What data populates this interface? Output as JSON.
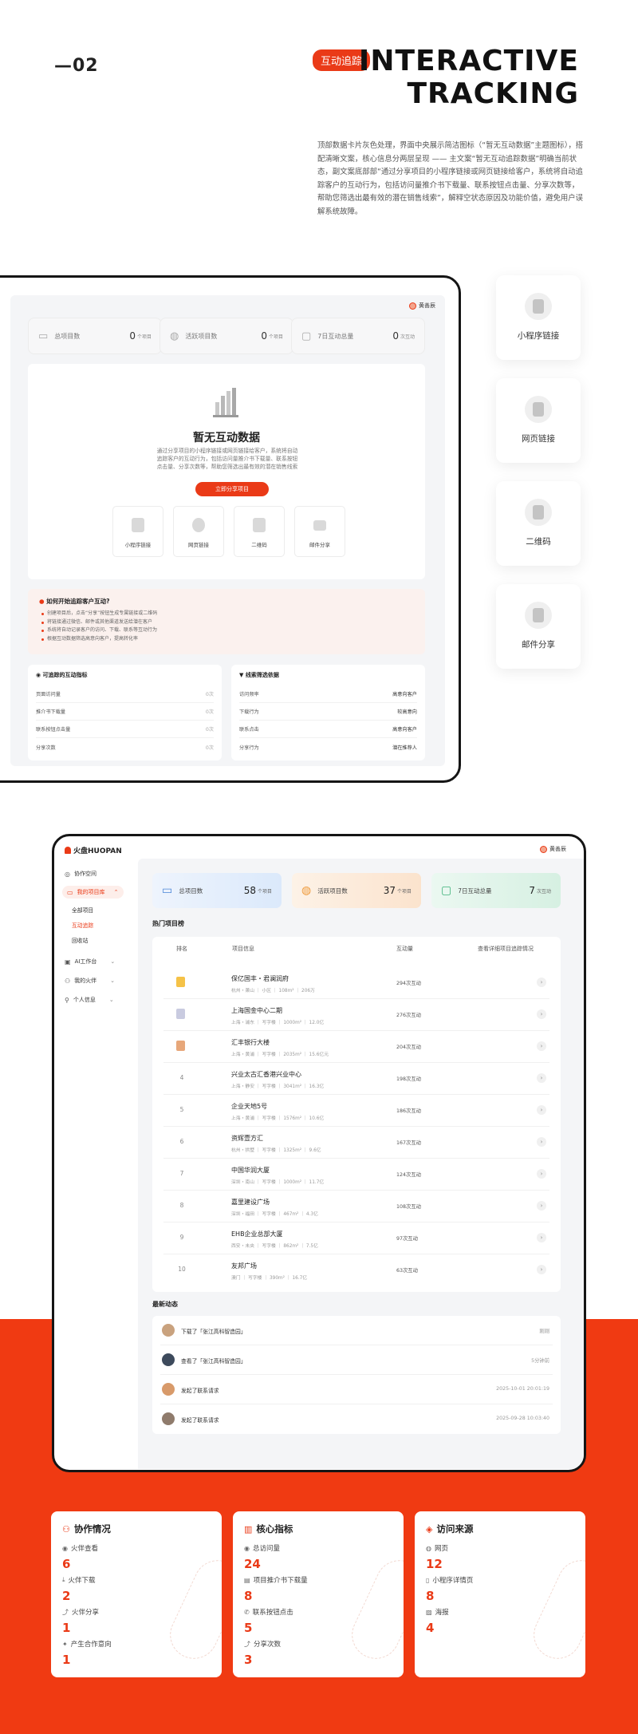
{
  "header": {
    "section_number": "—02",
    "tag": "互动追踪",
    "title_line1": "INTERACTIVE",
    "title_line2": "TRACKING",
    "description": "顶部数据卡片灰色处理，界面中央展示简洁图标（“暂无互动数据”主题图标），搭配清晰文案，核心信息分两层呈现 —— 主文案“暂无互动追踪数据”明确当前状态，副文案底部部“通过分享项目的小程序链接或网页链接给客户，系统将自动追踪客户的互动行为，包括访问量推介书下载量、联系按钮点击量、分享次数等，帮助您筛选出最有效的潜在销售线索”，解释空状态原因及功能价值，避免用户误解系统故障。"
  },
  "screen1": {
    "user": "黄善辰",
    "stats": [
      {
        "label": "总项目数",
        "value": "0",
        "unit": "个项目"
      },
      {
        "label": "活跃项目数",
        "value": "0",
        "unit": "个项目"
      },
      {
        "label": "7日互动总量",
        "value": "0",
        "unit": "次互动"
      }
    ],
    "empty_title": "暂无互动数据",
    "empty_desc": "通过分享项目的小程序链接或网页链接给客户，系统将自动追踪客户的互动行为，包括访问量推介书下载量、联系按钮点击量、分享次数等，帮助您筛选出最有效的潜在销售线索",
    "share_button": "立即分享项目",
    "share_options": [
      "小程序链接",
      "网页链接",
      "二维码",
      "邮件分享"
    ],
    "howto_title": "如何开始追踪客户互动?",
    "howto_items": [
      "创建项目后，点击“分享”按钮生成专属链接或二维码",
      "将链接通过微信、邮件或其他渠道发送给潜在客户",
      "系统将自动记录客户的访问、下载、联系等互动行为",
      "根据互动数据筛选高意向客户，提高转化率"
    ],
    "metrics_title": "可追踪的互动指标",
    "metrics": [
      {
        "label": "页面访问量",
        "value": "0次"
      },
      {
        "label": "推介书下载量",
        "value": "0次"
      },
      {
        "label": "联系按钮点击量",
        "value": "0次"
      },
      {
        "label": "分享次数",
        "value": "0次"
      }
    ],
    "leads_title": "线索筛选依据",
    "leads": [
      {
        "label": "访问频率",
        "value": "高意向客户"
      },
      {
        "label": "下载行为",
        "value": "较高意向"
      },
      {
        "label": "联系点击",
        "value": "高意向客户"
      },
      {
        "label": "分享行为",
        "value": "潜在推荐人"
      }
    ]
  },
  "side_cards": [
    "小程序链接",
    "网页链接",
    "二维码",
    "邮件分享"
  ],
  "screen2": {
    "brand": "火盘HUOPAN",
    "user": "黄善辰",
    "nav": {
      "collab": "协作空间",
      "my_projects": "我的项目库",
      "sub": [
        "全部项目",
        "互动追踪",
        "回收站"
      ],
      "ai": "AI工作台",
      "partners": "我的火伴",
      "profile": "个人信息"
    },
    "stats": [
      {
        "label": "总项目数",
        "value": "58",
        "unit": "个项目"
      },
      {
        "label": "活跃项目数",
        "value": "37",
        "unit": "个项目"
      },
      {
        "label": "7日互动总量",
        "value": "7",
        "unit": "次互动"
      }
    ],
    "hot_title": "热门项目榜",
    "columns": [
      "排名",
      "项目信息",
      "互动量",
      "查看详细项目追踪情况"
    ],
    "rows": [
      {
        "rank": "1",
        "name": "保亿国丰・君澜润府",
        "meta": "杭州・萧山 ｜ 小区 ｜ 108m² ｜ 206万",
        "count": "294次互动"
      },
      {
        "rank": "2",
        "name": "上海国金中心二期",
        "meta": "上海・浦东 ｜ 写字楼 ｜ 1000m² ｜ 12.0亿",
        "count": "276次互动"
      },
      {
        "rank": "3",
        "name": "汇丰银行大楼",
        "meta": "上海・黄浦 ｜ 写字楼 ｜ 2035m² ｜ 15.6亿元",
        "count": "204次互动"
      },
      {
        "rank": "4",
        "name": "兴业太古汇香港兴业中心",
        "meta": "上海・静安 ｜ 写字楼 ｜ 3041m² ｜ 16.3亿",
        "count": "198次互动"
      },
      {
        "rank": "5",
        "name": "企业天地5号",
        "meta": "上海・黄浦 ｜ 写字楼 ｜ 1576m² ｜ 10.6亿",
        "count": "186次互动"
      },
      {
        "rank": "6",
        "name": "资辉壹方汇",
        "meta": "杭州・拱墅 ｜ 写字楼 ｜ 1325m² ｜ 9.6亿",
        "count": "167次互动"
      },
      {
        "rank": "7",
        "name": "中国华润大厦",
        "meta": "深圳・南山 ｜ 写字楼 ｜ 1000m² ｜ 11.7亿",
        "count": "124次互动"
      },
      {
        "rank": "8",
        "name": "嘉里建设广场",
        "meta": "深圳・福田 ｜ 写字楼 ｜ 467m² ｜ 4.3亿",
        "count": "108次互动"
      },
      {
        "rank": "9",
        "name": "EHB企业总部大厦",
        "meta": "西安・未央 ｜ 写字楼 ｜ 862m² ｜ 7.5亿",
        "count": "97次互动"
      },
      {
        "rank": "10",
        "name": "友邦广场",
        "meta": "澳门 ｜ 写字楼 ｜ 390m² ｜ 16.7亿",
        "count": "63次互动"
      }
    ],
    "feed_title": "最新动态",
    "feed": [
      {
        "text": "下载了「张江高科智造园」",
        "time": "刚刚"
      },
      {
        "text": "查看了「张江高科智造园」",
        "time": "5分钟前"
      },
      {
        "text": "发起了联系请求",
        "time": "2025-10-01 20:01:19"
      },
      {
        "text": "发起了联系请求",
        "time": "2025-09-28 10:03:40"
      }
    ]
  },
  "bottom_cards": [
    {
      "title": "协作情况",
      "items": [
        {
          "label": "火伴查看",
          "value": "6"
        },
        {
          "label": "火伴下载",
          "value": "2"
        },
        {
          "label": "火伴分享",
          "value": "1"
        },
        {
          "label": "产生合作意向",
          "value": "1"
        }
      ]
    },
    {
      "title": "核心指标",
      "items": [
        {
          "label": "总访问量",
          "value": "24"
        },
        {
          "label": "项目推介书下载量",
          "value": "8"
        },
        {
          "label": "联系按钮点击",
          "value": "5"
        },
        {
          "label": "分享次数",
          "value": "3"
        }
      ]
    },
    {
      "title": "访问来源",
      "items": [
        {
          "label": "网页",
          "value": "12"
        },
        {
          "label": "小程序详情页",
          "value": "8"
        },
        {
          "label": "海报",
          "value": "4"
        }
      ]
    }
  ],
  "colors": {
    "accent": "#ea3a17",
    "orange_band": "#f03a12",
    "frame": "#151515"
  }
}
